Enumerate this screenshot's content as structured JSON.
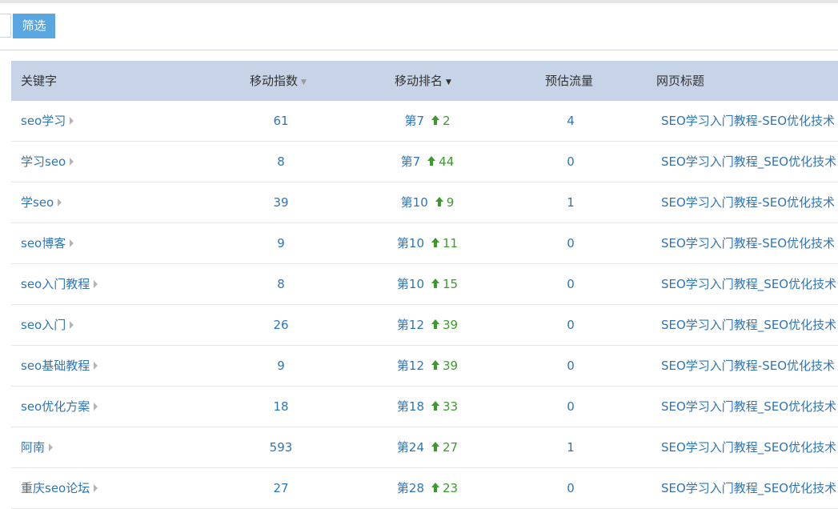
{
  "toolbar": {
    "filter_label": "筛选"
  },
  "table": {
    "headers": {
      "keyword": "关键字",
      "mobile_index": "移动指数",
      "mobile_rank": "移动排名",
      "est_traffic": "预估流量",
      "page_title": "网页标题"
    },
    "sort_icons": {
      "index": "▼",
      "rank": "▼"
    },
    "rows": [
      {
        "keyword": "seo学习",
        "index": "61",
        "rank": "第7",
        "change": "2",
        "traffic": "4",
        "title": "SEO学习入门教程-SEO优化技术"
      },
      {
        "keyword": "学习seo",
        "index": "8",
        "rank": "第7",
        "change": "44",
        "traffic": "0",
        "title": "SEO学习入门教程_SEO优化技术"
      },
      {
        "keyword": "学seo",
        "index": "39",
        "rank": "第10",
        "change": "9",
        "traffic": "1",
        "title": "SEO学习入门教程-SEO优化技术"
      },
      {
        "keyword": "seo博客",
        "index": "9",
        "rank": "第10",
        "change": "11",
        "traffic": "0",
        "title": "SEO学习入门教程-SEO优化技术"
      },
      {
        "keyword": "seo入门教程",
        "index": "8",
        "rank": "第10",
        "change": "15",
        "traffic": "0",
        "title": "SEO学习入门教程_SEO优化技术"
      },
      {
        "keyword": "seo入门",
        "index": "26",
        "rank": "第12",
        "change": "39",
        "traffic": "0",
        "title": "SEO学习入门教程_SEO优化技术"
      },
      {
        "keyword": "seo基础教程",
        "index": "9",
        "rank": "第12",
        "change": "39",
        "traffic": "0",
        "title": "SEO学习入门教程-SEO优化技术"
      },
      {
        "keyword": "seo优化方案",
        "index": "18",
        "rank": "第18",
        "change": "33",
        "traffic": "0",
        "title": "SEO学习入门教程_SEO优化技术"
      },
      {
        "keyword": "阿南",
        "index": "593",
        "rank": "第24",
        "change": "27",
        "traffic": "1",
        "title": "SEO学习入门教程_SEO优化技术"
      },
      {
        "keyword": "重庆seo论坛",
        "index": "27",
        "rank": "第28",
        "change": "23",
        "traffic": "0",
        "title": "SEO学习入门教程_SEO优化技术"
      }
    ]
  },
  "colors": {
    "header_bg": "#c7d3e6",
    "link": "#2f75b5",
    "up": "#3c9a2c",
    "button": "#5aa6e0"
  }
}
